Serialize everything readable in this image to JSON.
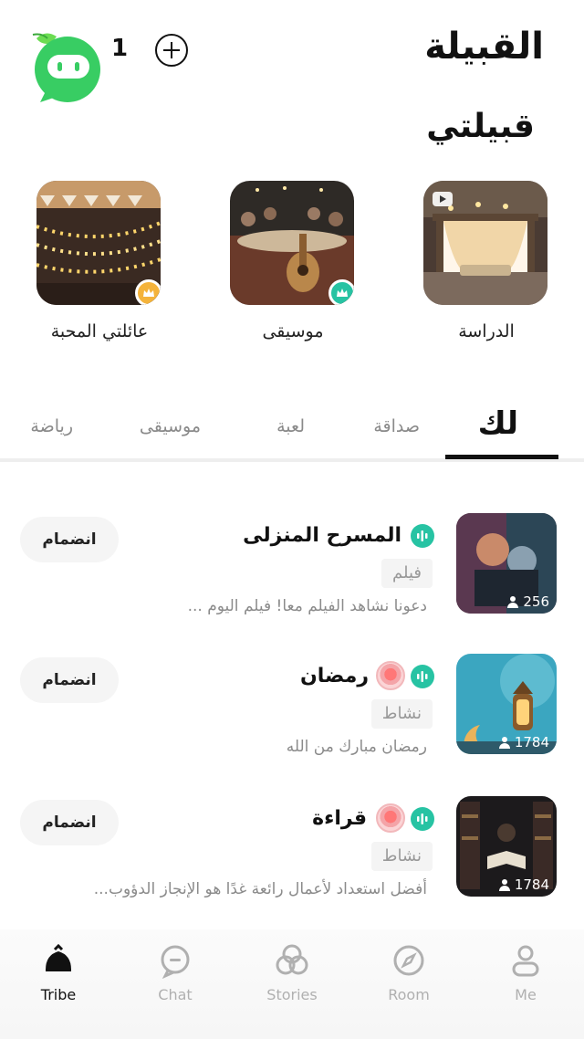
{
  "header": {
    "count": "1",
    "title": "القبيلة",
    "section_title": "قبيلتي"
  },
  "my_tribes": [
    {
      "name": "الدراسة",
      "badge": "video-icon"
    },
    {
      "name": "موسيقى",
      "badge": "crown-icon",
      "badge_color": "#27c3a3"
    },
    {
      "name": "عائلتي المحبة",
      "badge": "crown-icon",
      "badge_color": "#f4b33b"
    }
  ],
  "tabs": [
    "لك",
    "صداقة",
    "لعبة",
    "موسيقى",
    "رياضة"
  ],
  "active_tab": "لك",
  "tribes": [
    {
      "title": "المسرح المنزلى",
      "tag": "فيلم",
      "desc": "دعونا نشاهد الفيلم معا! فيلم اليوم ...",
      "members": "256",
      "join": "انضمام",
      "has_medal": false
    },
    {
      "title": "رمضان",
      "tag": "نشاط",
      "desc": "رمضان مبارك من الله",
      "members": "1784",
      "join": "انضمام",
      "has_medal": true
    },
    {
      "title": "قراءة",
      "tag": "نشاط",
      "desc": "أفضل استعداد لأعمال رائعة غدًا هو الإنجاز الدؤوب...",
      "members": "1784",
      "join": "انضمام",
      "has_medal": true
    }
  ],
  "bottom_nav": [
    {
      "label": "Tribe",
      "icon": "tribe-icon",
      "active": true
    },
    {
      "label": "Chat",
      "icon": "chat-icon",
      "active": false
    },
    {
      "label": "Stories",
      "icon": "stories-icon",
      "active": false
    },
    {
      "label": "Room",
      "icon": "compass-icon",
      "active": false
    },
    {
      "label": "Me",
      "icon": "person-icon",
      "active": false
    }
  ],
  "colors": {
    "accent": "#27c3a3",
    "logo": "#3ccf63",
    "crown_gold": "#f4b33b",
    "text": "#111111",
    "muted": "#8b8b8b"
  }
}
